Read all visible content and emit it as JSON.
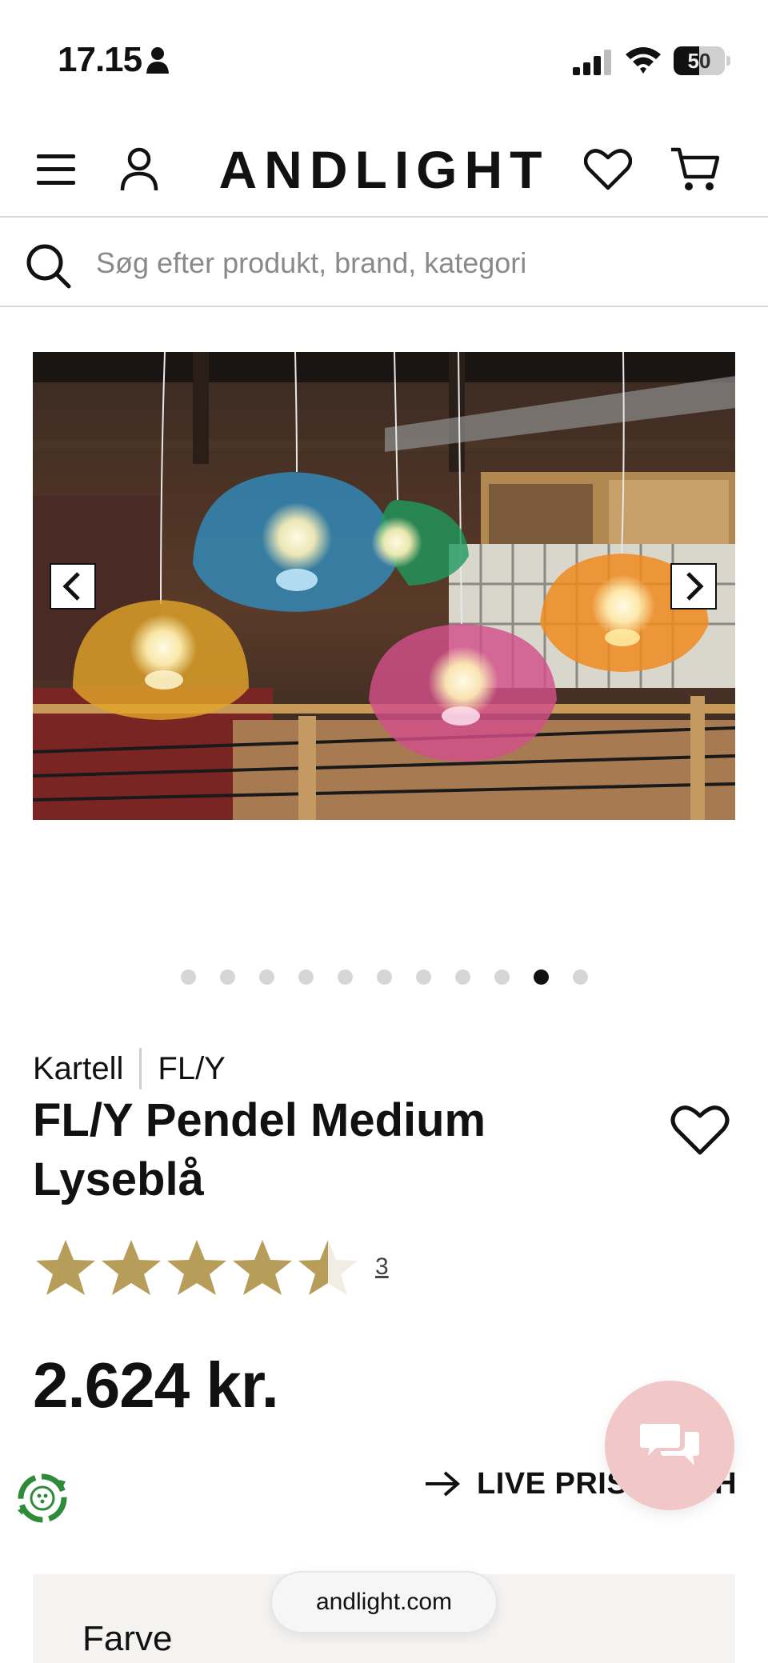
{
  "status_bar": {
    "time": "17.15",
    "battery_percent": 50,
    "battery_label": "50"
  },
  "header": {
    "brand": "ANDLIGHT",
    "icons": [
      "menu-icon",
      "user-icon",
      "heart-icon",
      "cart-icon"
    ]
  },
  "search": {
    "placeholder": "Søg efter produkt, brand, kategori",
    "value": ""
  },
  "carousel": {
    "slide_count": 11,
    "active_index": 9,
    "lamp_colors": [
      "#e0a42a",
      "#2f8fc4",
      "#1e9a5e",
      "#d24f8a",
      "#ee8a1e"
    ]
  },
  "product": {
    "brand": "Kartell",
    "series": "FL/Y",
    "title": "FL/Y Pendel Medium Lyseblå",
    "rating": 4.5,
    "review_count": "3",
    "price": "2.624 kr.",
    "star_color": "#b79d5a"
  },
  "actions": {
    "live_price_label": "LIVE PRISMATCH"
  },
  "options": {
    "color_label": "Farve"
  },
  "browser": {
    "url": "andlight.com"
  },
  "colors": {
    "chat_bubble": "#f2c7c8",
    "eco_green": "#2f8a3a"
  }
}
